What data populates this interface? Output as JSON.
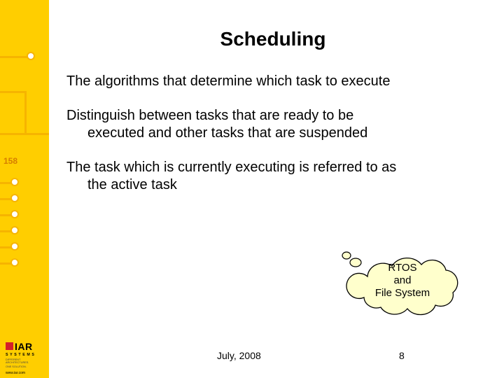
{
  "title": "Scheduling",
  "paragraphs": {
    "p1": "The algorithms that determine which task to execute",
    "p2_line1": "Distinguish between tasks that are ready to be",
    "p2_line2": "executed and other tasks that are suspended",
    "p3_line1": "The task which is currently executing is referred to as",
    "p3_line2": "the active task"
  },
  "cloud_text": "RTOS\nand\nFile System",
  "left_band_label": "158",
  "footer": {
    "date": "July, 2008",
    "page": "8"
  },
  "logo": {
    "brand": "IAR",
    "systems": "SYSTEMS",
    "tagline1": "DIFFERENT ARCHITECTURES.",
    "tagline2": "ONE SOLUTION.",
    "url": "www.iar.com"
  }
}
